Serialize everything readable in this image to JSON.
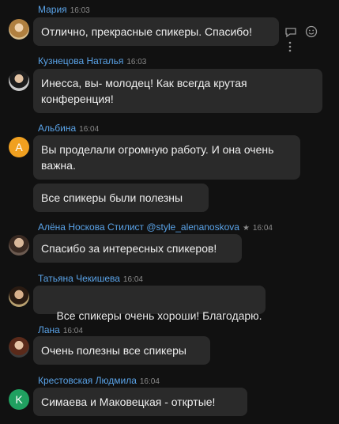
{
  "messages": [
    {
      "author": "Мария",
      "time": "16:03",
      "text": "Отлично, прекрасные спикеры. Спасибо!"
    },
    {
      "author": "Кузнецова Наталья",
      "time": "16:03",
      "text": "Инесса, вы- молодец! Как всегда крутая конференция!"
    },
    {
      "author": "Альбина",
      "time": "16:04",
      "avatar_letter": "A",
      "text": "Вы проделали огромную работу. И она очень важна.",
      "text2": "Все спикеры были  полезны"
    },
    {
      "author": "Алёна Носкова Стилист @style_alenanoskova",
      "time": "16:04",
      "text": "Спасибо за интересных спикеров!"
    },
    {
      "author": "Татьяна Чекишева",
      "time": "16:04",
      "text": " Все спикеры очень хороши! Благодарю."
    },
    {
      "author": "Лана",
      "time": "16:04",
      "text": "Очень полезны все спикеры"
    },
    {
      "author": "Крестовская Людмила",
      "time": "16:04",
      "avatar_letter": "K",
      "text": "Симаева и Маковецкая - откртые!"
    }
  ],
  "icons": {
    "reply": "reply-icon",
    "emoji": "emoji-icon",
    "more": "more-icon"
  },
  "colors": {
    "author_name": "#5aa3e8",
    "bubble": "#2a2a2a",
    "background": "#111111"
  }
}
